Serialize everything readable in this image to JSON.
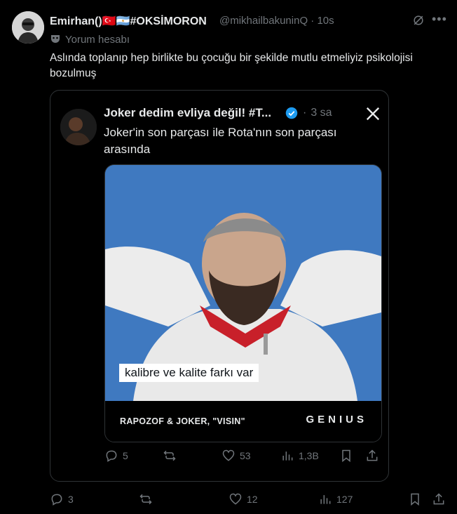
{
  "tweet": {
    "display_name": "Emirhan()🇹🇷🇦🇷#OKSİMORON",
    "handle": "@mikhailbakuninQ · 10s",
    "subtext": "Yorum hesabı",
    "text": "Aslında toplanıp hep birlikte bu çocuğu bir şekilde mutlu etmeliyiz psikolojisi bozulmuş",
    "actions": {
      "reply": "3",
      "retweet": "",
      "like": "12",
      "views": "127"
    }
  },
  "quoted": {
    "display_name": "Joker dedim evliya değil! #T...",
    "time": "3 sa",
    "text": "Joker'in son parçası ile Rota'nın son parçası arasında",
    "media": {
      "caption": "kalibre ve kalite farkı var",
      "footer_left": "RAPOZOF & JOKER, \"VISIN\"",
      "footer_right": "GENIUS"
    },
    "actions": {
      "reply": "5",
      "retweet": "",
      "like": "53",
      "views": "1,3B"
    }
  },
  "colors": {
    "accent": "#1d9bf0",
    "muted": "#71767b",
    "photo_bg": "#3f79c0"
  }
}
